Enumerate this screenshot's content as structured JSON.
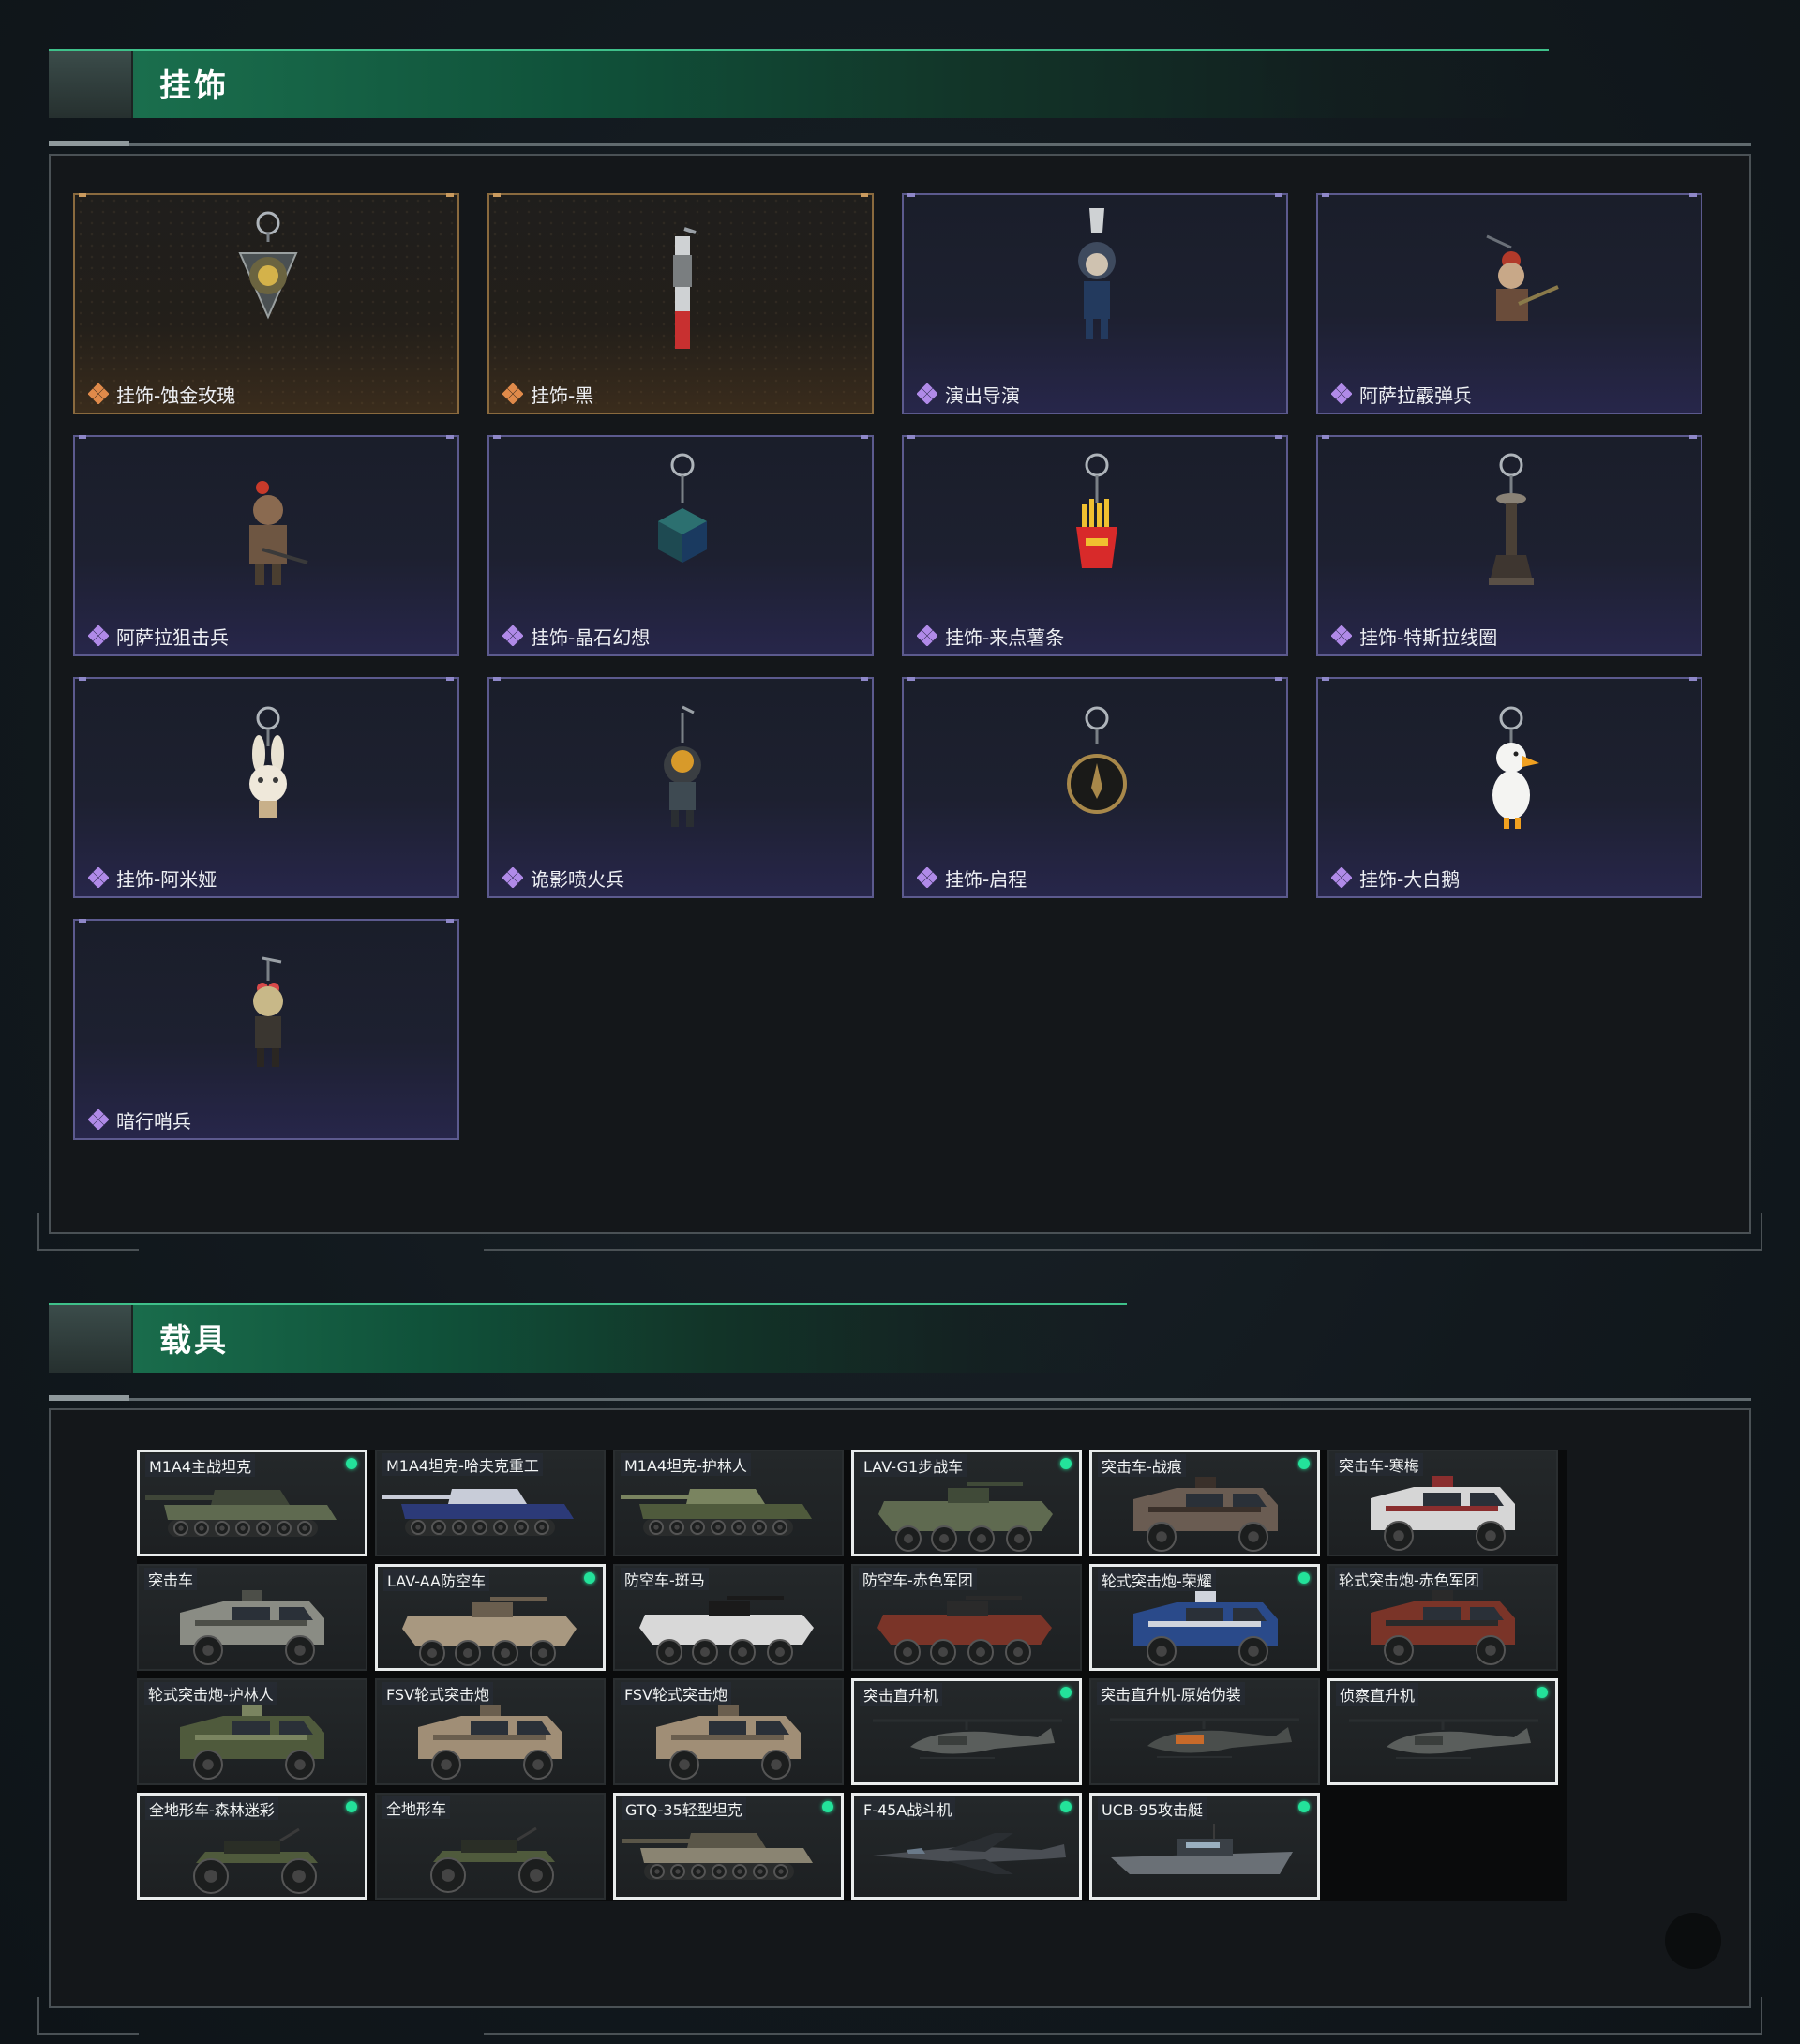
{
  "sections": {
    "charms": {
      "title": "挂饰",
      "items": [
        {
          "name": "挂饰-蚀金玫瑰",
          "rarity": "gold",
          "icon": "rose-pendant-icon"
        },
        {
          "name": "挂饰-黑",
          "rarity": "gold",
          "icon": "blade-tag-icon"
        },
        {
          "name": "演出导演",
          "rarity": "purple",
          "icon": "director-figure-icon"
        },
        {
          "name": "阿萨拉霰弹兵",
          "rarity": "purple",
          "icon": "shotgunner-figure-icon"
        },
        {
          "name": "阿萨拉狙击兵",
          "rarity": "purple",
          "icon": "sniper-figure-icon"
        },
        {
          "name": "挂饰-晶石幻想",
          "rarity": "purple",
          "icon": "crystal-cube-icon"
        },
        {
          "name": "挂饰-来点薯条",
          "rarity": "purple",
          "icon": "fries-icon"
        },
        {
          "name": "挂饰-特斯拉线圈",
          "rarity": "purple",
          "icon": "tesla-coil-icon"
        },
        {
          "name": "挂饰-阿米娅",
          "rarity": "purple",
          "icon": "bunny-figure-icon"
        },
        {
          "name": "诡影喷火兵",
          "rarity": "purple",
          "icon": "flamethrower-figure-icon"
        },
        {
          "name": "挂饰-启程",
          "rarity": "purple",
          "icon": "medal-coin-icon"
        },
        {
          "name": "挂饰-大白鹅",
          "rarity": "purple",
          "icon": "goose-figure-icon"
        },
        {
          "name": "暗行哨兵",
          "rarity": "purple",
          "icon": "sentinel-figure-icon"
        }
      ]
    },
    "vehicles": {
      "title": "载具",
      "items": [
        {
          "name": "M1A4主战坦克",
          "selected": true,
          "owned_dot": true,
          "kind": "tank",
          "body": "#5f6a50",
          "accent": "#3f4638"
        },
        {
          "name": "M1A4坦克-哈夫克重工",
          "selected": false,
          "owned_dot": false,
          "kind": "tank",
          "body": "#2c3a78",
          "accent": "#c8ccd8"
        },
        {
          "name": "M1A4坦克-护林人",
          "selected": false,
          "owned_dot": false,
          "kind": "tank",
          "body": "#4f5a3c",
          "accent": "#7a8460"
        },
        {
          "name": "LAV-G1步战车",
          "selected": true,
          "owned_dot": true,
          "kind": "apc",
          "body": "#5f6a50",
          "accent": "#404a38"
        },
        {
          "name": "突击车-战痕",
          "selected": true,
          "owned_dot": true,
          "kind": "truck",
          "body": "#6a5c52",
          "accent": "#3a302a"
        },
        {
          "name": "突击车-寒梅",
          "selected": false,
          "owned_dot": false,
          "kind": "truck",
          "body": "#d6d6d6",
          "accent": "#8a2e2e"
        },
        {
          "name": "突击车",
          "selected": false,
          "owned_dot": false,
          "kind": "truck",
          "body": "#8a8c84",
          "accent": "#4c4e48"
        },
        {
          "name": "LAV-AA防空车",
          "selected": true,
          "owned_dot": true,
          "kind": "apc",
          "body": "#a89880",
          "accent": "#6a5e4e"
        },
        {
          "name": "防空车-斑马",
          "selected": false,
          "owned_dot": false,
          "kind": "apc",
          "body": "#d8d8d8",
          "accent": "#1a1a1a"
        },
        {
          "name": "防空车-赤色军团",
          "selected": false,
          "owned_dot": false,
          "kind": "apc",
          "body": "#7a3428",
          "accent": "#2a2a2a"
        },
        {
          "name": "轮式突击炮-荣耀",
          "selected": true,
          "owned_dot": true,
          "kind": "truck",
          "body": "#2a4a8a",
          "accent": "#d0d4dc"
        },
        {
          "name": "轮式突击炮-赤色军团",
          "selected": false,
          "owned_dot": false,
          "kind": "truck",
          "body": "#7a3428",
          "accent": "#2a2a2a"
        },
        {
          "name": "轮式突击炮-护林人",
          "selected": false,
          "owned_dot": false,
          "kind": "truck",
          "body": "#4f5a3c",
          "accent": "#7a8460"
        },
        {
          "name": "FSV轮式突击炮",
          "selected": false,
          "owned_dot": false,
          "kind": "truck",
          "body": "#a08e76",
          "accent": "#6a5e4e"
        },
        {
          "name": "FSV轮式突击炮",
          "selected": false,
          "owned_dot": false,
          "kind": "truck",
          "body": "#a08e76",
          "accent": "#6a5e4e"
        },
        {
          "name": "突击直升机",
          "selected": true,
          "owned_dot": true,
          "kind": "heli",
          "body": "#5a5e5c",
          "accent": "#3a3e3c"
        },
        {
          "name": "突击直升机-原始伪装",
          "selected": false,
          "owned_dot": false,
          "kind": "heli",
          "body": "#4a4e4c",
          "accent": "#c86a2a"
        },
        {
          "name": "侦察直升机",
          "selected": true,
          "owned_dot": true,
          "kind": "heli",
          "body": "#5a5e5c",
          "accent": "#3a3e3c"
        },
        {
          "name": "全地形车-森林迷彩",
          "selected": true,
          "owned_dot": true,
          "kind": "atv",
          "body": "#4f5a3c",
          "accent": "#2a2e26"
        },
        {
          "name": "全地形车",
          "selected": false,
          "owned_dot": false,
          "kind": "atv",
          "body": "#4f5a3c",
          "accent": "#2a2e26"
        },
        {
          "name": "GTQ-35轻型坦克",
          "selected": true,
          "owned_dot": true,
          "kind": "tank",
          "body": "#8a8472",
          "accent": "#5a5648"
        },
        {
          "name": "F-45A战斗机",
          "selected": true,
          "owned_dot": true,
          "kind": "jet",
          "body": "#4a4e54",
          "accent": "#2a2e32"
        },
        {
          "name": "UCB-95攻击艇",
          "selected": true,
          "owned_dot": true,
          "kind": "boat",
          "body": "#6a7076",
          "accent": "#3a4046"
        }
      ]
    }
  },
  "colors": {
    "accent_green": "#23e29a",
    "header_green": "#1a6e4d",
    "rarity_gold": "#e08a4a",
    "rarity_purple": "#b08ae8",
    "panel_bg": "#14171a"
  }
}
